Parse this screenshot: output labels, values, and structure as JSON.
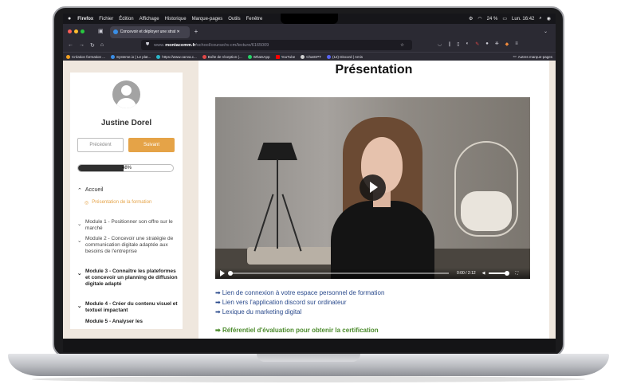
{
  "menubar": {
    "apple": "",
    "app": "Firefox",
    "items": [
      "Fichier",
      "Édition",
      "Affichage",
      "Historique",
      "Marque-pages",
      "Outils",
      "Fenêtre"
    ],
    "battery": "24 %",
    "clock": "Lun. 16:42"
  },
  "browser": {
    "tab_title": "Concevoir et déployer une strat ✕",
    "url_prefix": "www.",
    "url_domain": "montacomm.fr",
    "url_path": "/school/course/rs-cm/lecture/6165009",
    "bookmarks": [
      "Création formation ...",
      "Systeme.io | Le plat...",
      "https://www.canva.c...",
      "Boîte de réception (...",
      "WhatsApp",
      "YouTube",
      "ChatGPT",
      "(12) Discord | Amis"
    ],
    "other_bookmarks": "Autres marque-pages"
  },
  "sidebar": {
    "user_name": "Justine Dorel",
    "prev_label": "Précédent",
    "next_label": "Suivant",
    "progress_label": "48%",
    "progress_value": 0.48,
    "home_label": "Accueil",
    "active_lesson": "Présentation de la formation",
    "modules": [
      "Module 1 - Positionner son offre sur le marché",
      "Module 2 - Concevoir une stratégie de communication digitale adaptée aux besoins de l'entreprise",
      "Module 3 - Connaître les plateformes et concevoir un planning de diffusion digitale adapté",
      "Module 4 - Créer du contenu visuel et textuel impactant",
      "Module 5 - Analyser les"
    ]
  },
  "content": {
    "title": "Présentation",
    "video_time": "0:00 / 2:12",
    "links": [
      "Lien de connexion à votre espace personnel de formation",
      "Lien vers l'application discord sur ordinateur",
      "Lexique du marketing digital"
    ],
    "certification": "Référentiel d'évaluation pour obtenir la certification"
  }
}
